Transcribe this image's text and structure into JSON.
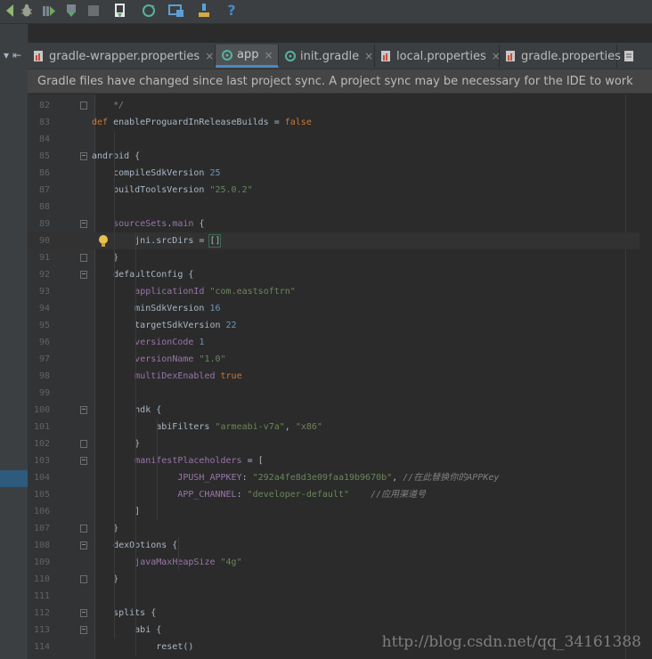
{
  "toolbar": {
    "icons": [
      "run-arrow-icon",
      "debug-icon",
      "run-coverage-icon",
      "attach-debugger-icon",
      "stop-icon",
      "sdk-manager-icon",
      "sync-gradle-icon",
      "avd-manager-icon",
      "android-monitor-icon",
      "help-icon"
    ]
  },
  "left_strip": {
    "buttons": [
      "dropdown-icon",
      "collapse-icon"
    ]
  },
  "tabs": [
    {
      "label": "gradle-wrapper.properties",
      "icon": "properties-file-icon",
      "active": false,
      "close": "×"
    },
    {
      "label": "app",
      "icon": "gradle-file-icon",
      "active": true,
      "close": "×"
    },
    {
      "label": "init.gradle",
      "icon": "gradle-file-icon",
      "active": false,
      "close": "×"
    },
    {
      "label": "local.properties",
      "icon": "properties-file-icon",
      "active": false,
      "close": "×"
    },
    {
      "label": "gradle.properties",
      "icon": "properties-file-icon",
      "active": false,
      "close": "×"
    }
  ],
  "banner": {
    "text": "Gradle files have changed since last project sync. A project sync may be necessary for the IDE to work properly."
  },
  "editor": {
    "lines": [
      {
        "num": "82",
        "text": "    */"
      },
      {
        "num": "83",
        "text": "def enableProguardInReleaseBuilds = false"
      },
      {
        "num": "84",
        "text": ""
      },
      {
        "num": "85",
        "text": "android {"
      },
      {
        "num": "86",
        "text": "    compileSdkVersion 25"
      },
      {
        "num": "87",
        "text": "    buildToolsVersion \"25.0.2\""
      },
      {
        "num": "88",
        "text": ""
      },
      {
        "num": "89",
        "text": "    sourceSets.main {"
      },
      {
        "num": "90",
        "text": "        jni.srcDirs = []"
      },
      {
        "num": "91",
        "text": "    }"
      },
      {
        "num": "92",
        "text": "    defaultConfig {"
      },
      {
        "num": "93",
        "text": "        applicationId \"com.eastsoftrn\""
      },
      {
        "num": "94",
        "text": "        minSdkVersion 16"
      },
      {
        "num": "95",
        "text": "        targetSdkVersion 22"
      },
      {
        "num": "96",
        "text": "        versionCode 1"
      },
      {
        "num": "97",
        "text": "        versionName \"1.0\""
      },
      {
        "num": "98",
        "text": "        multiDexEnabled true"
      },
      {
        "num": "99",
        "text": ""
      },
      {
        "num": "100",
        "text": "        ndk {"
      },
      {
        "num": "101",
        "text": "            abiFilters \"armeabi-v7a\", \"x86\""
      },
      {
        "num": "102",
        "text": "        }"
      },
      {
        "num": "103",
        "text": "        manifestPlaceholders = ["
      },
      {
        "num": "104",
        "text": "                JPUSH_APPKEY: \"292a4fe8d3e09faa19b9670b\", //在此替换你的APPKey"
      },
      {
        "num": "105",
        "text": "                APP_CHANNEL: \"developer-default\"    //应用渠道号"
      },
      {
        "num": "106",
        "text": "        ]"
      },
      {
        "num": "107",
        "text": "    }"
      },
      {
        "num": "108",
        "text": "    dexOptions {"
      },
      {
        "num": "109",
        "text": "        javaMaxHeapSize \"4g\""
      },
      {
        "num": "110",
        "text": "    }"
      },
      {
        "num": "111",
        "text": ""
      },
      {
        "num": "112",
        "text": "    splits {"
      },
      {
        "num": "113",
        "text": "        abi {"
      },
      {
        "num": "114",
        "text": "            reset()"
      }
    ],
    "highlighted_line": "90"
  },
  "watermark": "http://blog.csdn.net/qq_34161388",
  "colors": {
    "background": "#2b2b2b",
    "keyword": "#cc7832",
    "string": "#6a8759",
    "number": "#6897bb",
    "property": "#9876aa",
    "comment": "#808080",
    "accent": "#4a88c7"
  }
}
